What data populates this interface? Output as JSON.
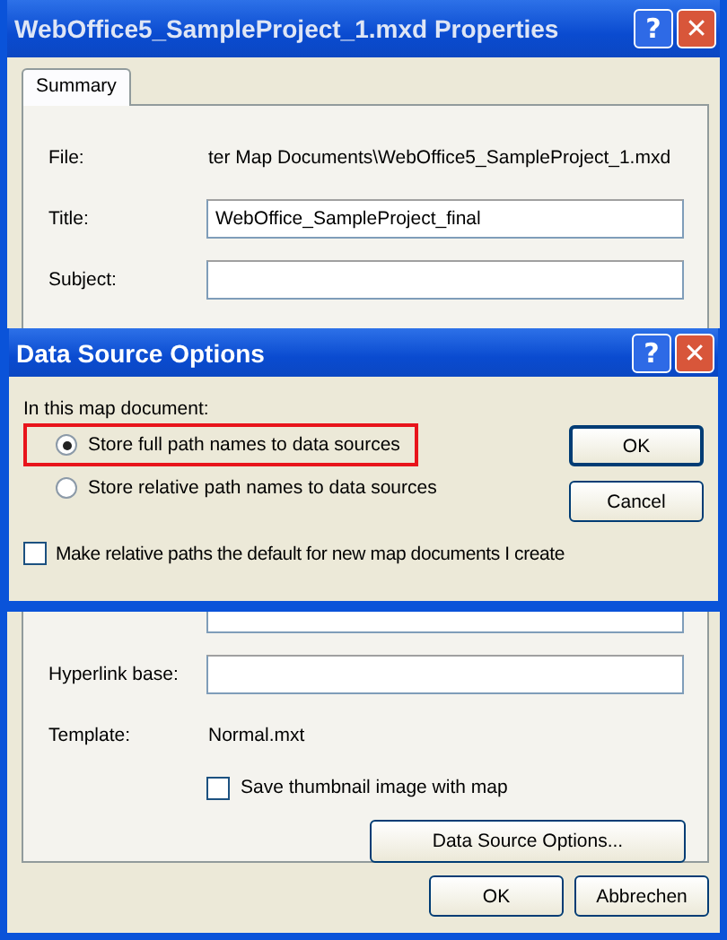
{
  "window": {
    "title": "WebOffice5_SampleProject_1.mxd Properties"
  },
  "title_buttons": [
    "?",
    "✕"
  ],
  "tabs": [
    {
      "label": "Summary",
      "selected": true
    }
  ],
  "fields": [
    {
      "kind": "text",
      "label": "File:",
      "value": "ter Map Documents\\WebOffice5_SampleProject_1.mxd"
    },
    {
      "kind": "input",
      "label": "Title:",
      "value": "WebOffice_SampleProject_final"
    },
    {
      "kind": "input",
      "label": "Subject:"
    }
  ],
  "lower_fields": [
    {
      "kind": "input",
      "label": "Hyperlink base:"
    },
    {
      "kind": "text",
      "label": "Template:",
      "value": "Normal.mxt"
    }
  ],
  "thumbnail_checkbox": {
    "label": "Save thumbnail image with map",
    "checked": false
  },
  "data_source_button": "Data Source Options...",
  "buttons": [
    "OK",
    "Abbrechen"
  ],
  "modal": {
    "title": "Data Source Options",
    "title_buttons": [
      "?",
      "✕"
    ],
    "group_label": "In this map document:",
    "options": [
      {
        "label": "Store full path names to data sources",
        "selected": true,
        "highlighted": true
      },
      {
        "label": "Store relative path names to data sources",
        "selected": false,
        "highlighted": false
      }
    ],
    "checkbox": {
      "label": "Make relative paths the default for new map documents I create",
      "checked": false
    },
    "buttons": [
      "OK",
      "Cancel"
    ]
  }
}
